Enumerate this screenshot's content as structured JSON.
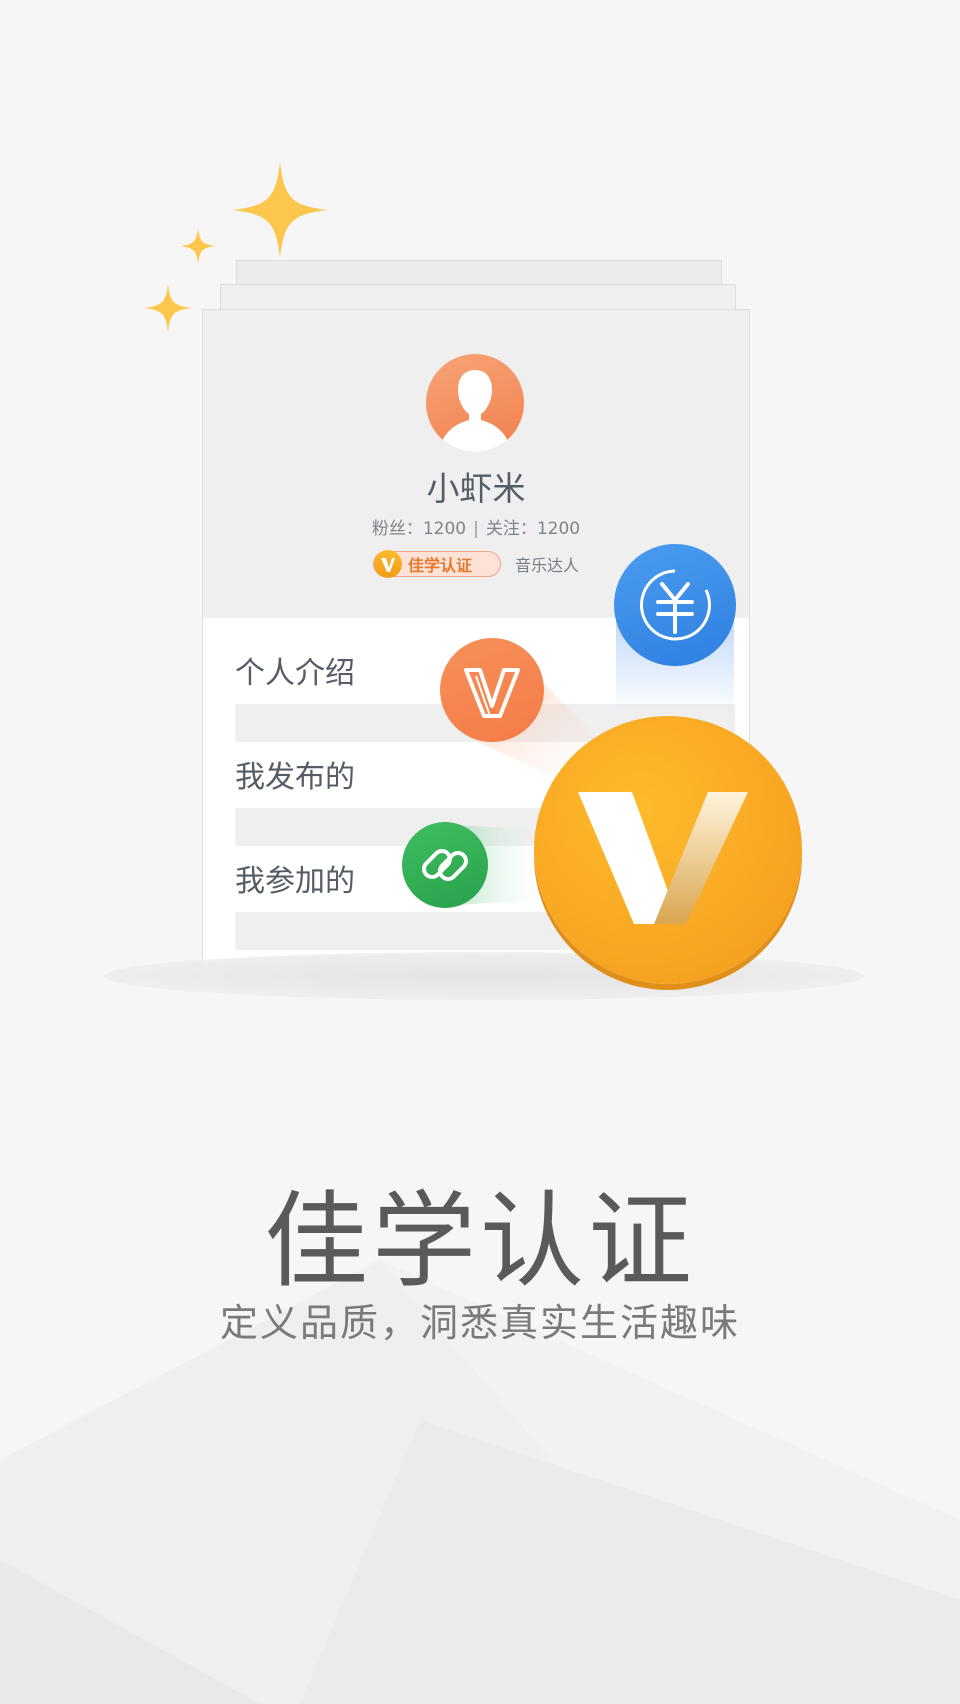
{
  "profile": {
    "name": "小虾米",
    "fans_label": "粉丝：",
    "fans_count": "1200",
    "separator": "|",
    "following_label": "关注：",
    "following_count": "1200",
    "badge_label": "佳学认证",
    "tag": "音乐达人"
  },
  "menu": [
    {
      "label": "个人介绍"
    },
    {
      "label": "我发布的"
    },
    {
      "label": "我参加的"
    }
  ],
  "headline": "佳学认证",
  "subtitle": "定义品质，洞悉真实生活趣味",
  "icons": {
    "avatar": "user-silhouette-icon",
    "badge": "v-badge-icon",
    "yuan": "yuan-coin-icon",
    "v_small": "v-coin-icon",
    "link": "link-chain-icon",
    "v_large": "v-coin-large-icon",
    "sparkles": "sparkle-icon"
  },
  "colors": {
    "accent_orange": "#f47c48",
    "accent_blue": "#3a8ae6",
    "accent_green": "#2fae53",
    "accent_gold": "#f9a824",
    "text_dark": "#5a5a5a"
  }
}
